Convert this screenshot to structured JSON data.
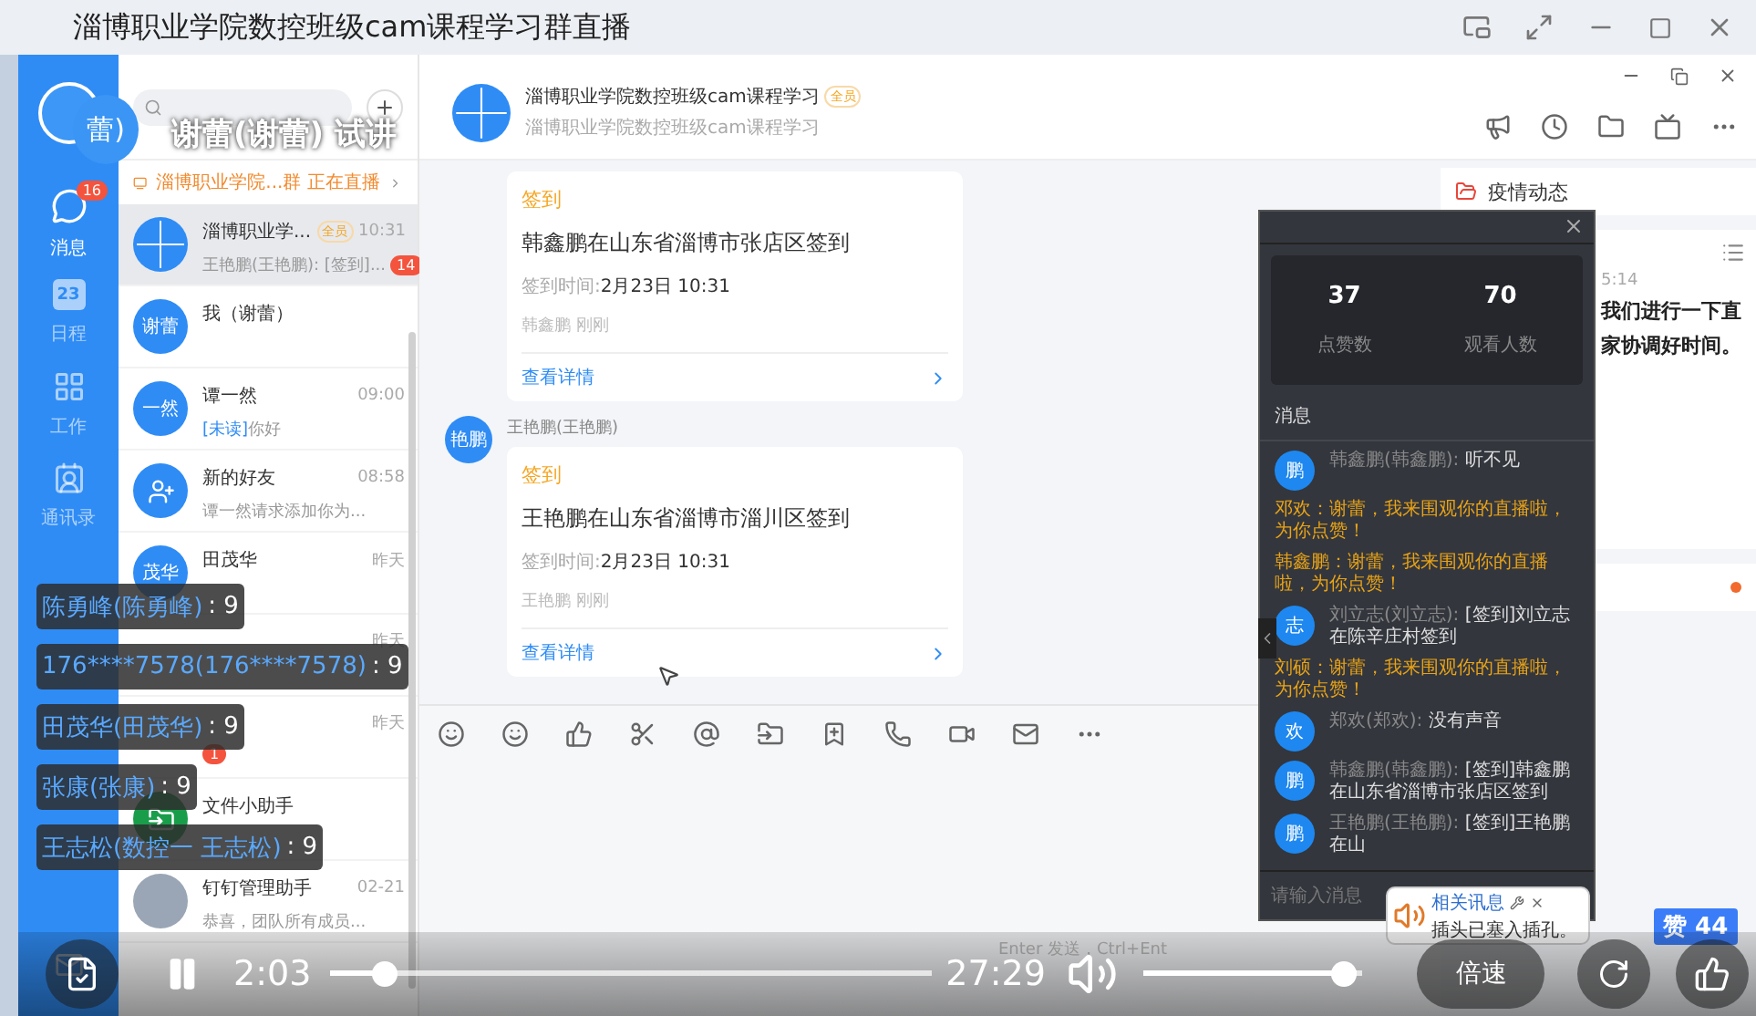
{
  "window": {
    "title": "淄博职业学院数控班级cam课程学习群直播"
  },
  "presenter": {
    "avatar_text": "蕾)",
    "label": "谢蕾(谢蕾) 试讲"
  },
  "nav": {
    "items": [
      {
        "kind": "chat",
        "label": "消息",
        "badge": "16",
        "selected": true
      },
      {
        "kind": "calendar",
        "label": "日程",
        "icon_text": "23",
        "selected": false
      },
      {
        "kind": "apps",
        "label": "工作",
        "selected": false
      },
      {
        "kind": "contacts",
        "label": "通讯录",
        "selected": false
      }
    ]
  },
  "live_banner": {
    "text": "淄博职业学院...群 正在直播"
  },
  "conversations": [
    {
      "kind": "group",
      "name": "淄博职业学...",
      "tag": "全员",
      "time": "10:31",
      "preview": "王艳鹏(王艳鹏): [签到]...",
      "badge": "14",
      "selected": true
    },
    {
      "kind": "text",
      "avatar_text": "谢蕾",
      "name": "我（谢蕾）",
      "selected": false
    },
    {
      "kind": "text",
      "avatar_text": "一然",
      "name": "谭一然",
      "time": "09:00",
      "unread_tag": "[未读]",
      "preview": "你好",
      "selected": false
    },
    {
      "kind": "add-user",
      "name": "新的好友",
      "time": "08:58",
      "preview": "谭一然请求添加你为...",
      "selected": false
    },
    {
      "kind": "text",
      "avatar_text": "茂华",
      "name": "田茂华",
      "time": "昨天",
      "selected": false
    },
    {
      "time": "昨天",
      "selected": false
    },
    {
      "time": "昨天",
      "badge": "1",
      "selected": false
    },
    {
      "kind": "file",
      "name": "文件小助手",
      "selected": false
    },
    {
      "kind": "photo",
      "name": "钉钉管理助手",
      "time": "02-21",
      "preview": "恭喜，团队所有成员...",
      "selected": false
    }
  ],
  "chat": {
    "title": "淄博职业学院数控班级cam课程学习",
    "tag": "全员",
    "subtitle": "淄博职业学院数控班级cam课程学习",
    "messages": [
      {
        "card_title": "签到",
        "body": "韩鑫鹏在山东省淄博市张店区签到",
        "time_label": "签到时间:",
        "time": "2月23日 10:31",
        "footer": "韩鑫鹏 刚刚",
        "link": "查看详情"
      },
      {
        "sender": "王艳鹏(王艳鹏)",
        "avatar_text": "艳鹏",
        "card_title": "签到",
        "body": "王艳鹏在山东省淄博市淄川区签到",
        "time_label": "签到时间:",
        "time": "2月23日 10:31",
        "footer": "王艳鹏 刚刚",
        "link": "查看详情"
      }
    ],
    "input_hint": "Enter 发送，Ctrl+Ent"
  },
  "side_panel": {
    "news_title": "疫情动态",
    "time_fragment": "5:14",
    "text_lines": [
      "我们进行一下直",
      "家协调好时间。"
    ]
  },
  "live_panel": {
    "stats": [
      {
        "value": "37",
        "label": "点赞数"
      },
      {
        "value": "70",
        "label": "观看人数"
      }
    ],
    "messages_title": "消息",
    "messages": [
      {
        "kind": "user",
        "avatar_text": "鹏",
        "name": "韩鑫鹏(韩鑫鹏):",
        "text": "听不见"
      },
      {
        "kind": "like",
        "text": "邓欢：谢蕾，我来围观你的直播啦，为你点赞！"
      },
      {
        "kind": "like",
        "text": "韩鑫鹏：谢蕾，我来围观你的直播啦，为你点赞！"
      },
      {
        "kind": "user",
        "avatar_text": "志",
        "name": "刘立志(刘立志):",
        "text": "[签到]刘立志在陈辛庄村签到"
      },
      {
        "kind": "like",
        "text": "刘硕：谢蕾，我来围观你的直播啦，为你点赞！"
      },
      {
        "kind": "user",
        "avatar_text": "欢",
        "name": "郑欢(郑欢):",
        "text": "没有声音"
      },
      {
        "kind": "user",
        "avatar_text": "鹏",
        "name": "韩鑫鹏(韩鑫鹏):",
        "text": "[签到]韩鑫鹏在山东省淄博市张店区签到"
      },
      {
        "kind": "user",
        "avatar_text": "鹏",
        "name": "王艳鹏(王艳鹏):",
        "text": "[签到]王艳鹏在山"
      }
    ],
    "input_placeholder": "请输入消息"
  },
  "danmaku": [
    {
      "name": "陈勇峰(陈勇峰)",
      "count": ": 9"
    },
    {
      "name": "176****7578(176****7578)",
      "count": ": 9"
    },
    {
      "name": "田茂华(田茂华)",
      "count": ": 9"
    },
    {
      "name": "张康(张康)",
      "count": ": 9"
    },
    {
      "name": "王志松(数控一 王志松)",
      "count": ": 9"
    }
  ],
  "notification": {
    "title": "相关讯息",
    "text": "插头已塞入插孔。"
  },
  "player": {
    "playing": true,
    "elapsed": "2:03",
    "duration": "27:29",
    "progress": {
      "level": 0.075
    },
    "volume": {
      "level": 0.97
    },
    "speed_label": "倍速",
    "likes_badge": "赞 44"
  }
}
